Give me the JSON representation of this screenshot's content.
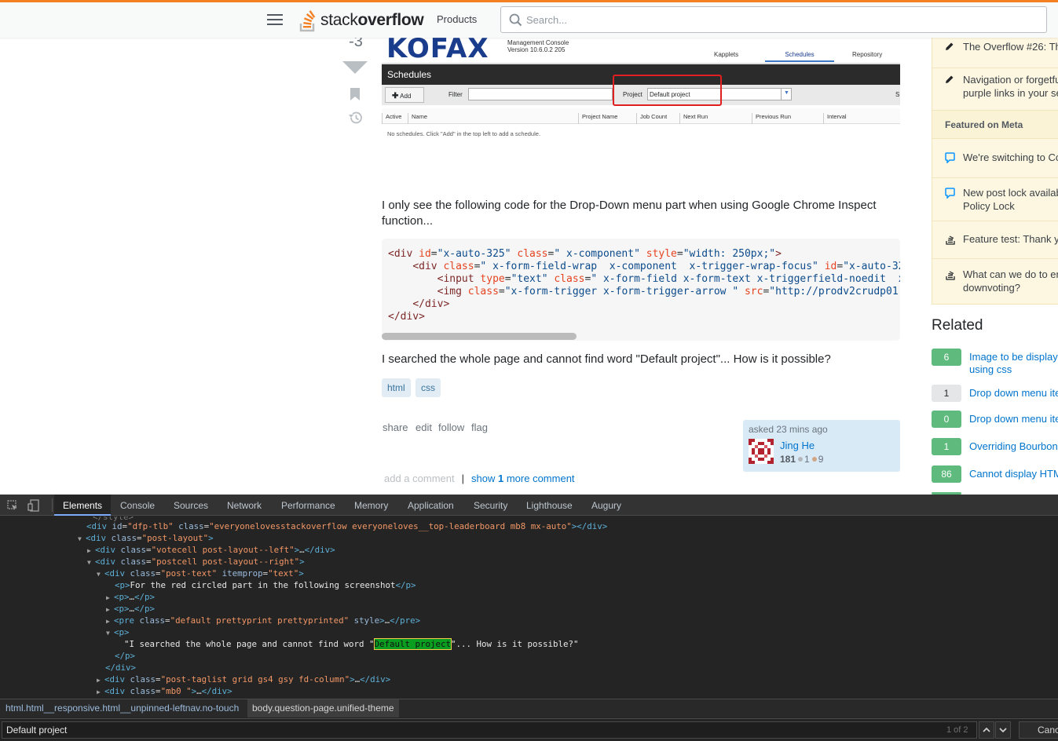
{
  "topbar": {
    "logo_prefix": "stack",
    "logo_bold": "overflow",
    "products_label": "Products",
    "search_placeholder": "Search..."
  },
  "vote": {
    "count": "-3"
  },
  "kofax_image": {
    "logo": "KOFAX",
    "subtitle_1": "Management Console",
    "subtitle_2": "Version 10.6.0.2 205",
    "tabs": [
      "Kapplets",
      "Schedules",
      "Repository"
    ],
    "header": "Schedules",
    "add_label": "Add",
    "filter_label": "Filter",
    "project_label": "Project",
    "project_value": "Default project",
    "trailing_label": "S",
    "columns": [
      "Active",
      "Name",
      "Project Name",
      "Job Count",
      "Next Run",
      "Previous Run",
      "Interval"
    ],
    "empty_message": "No schedules. Click \"Add\" in the top left to add a schedule."
  },
  "post": {
    "paragraph_1": "I only see the following code for the Drop-Down menu part when using Google Chrome Inspect function...",
    "code_lines": [
      [
        "<div ",
        "id",
        "=",
        "\"x-auto-325\"",
        " ",
        "class",
        "=",
        "\" x-component\"",
        " ",
        "style",
        "=",
        "\"width: 250px;\"",
        ">"
      ],
      [
        "    <div ",
        "class",
        "=",
        "\" x-form-field-wrap  x-component  x-trigger-wrap-focus\"",
        " ",
        "id",
        "=",
        "\"x-auto-32",
        "",
        "",
        "",
        "",
        ""
      ],
      [
        "        <input ",
        "type",
        "=",
        "\"text\"",
        " ",
        "class",
        "=",
        "\" x-form-field x-form-text x-triggerfield-noedit  x",
        "",
        "",
        "",
        "",
        ""
      ],
      [
        "        <img ",
        "class",
        "=",
        "\"x-form-trigger x-form-trigger-arrow \"",
        " ",
        "src",
        "=",
        "\"http://prodv2crudp01",
        "",
        "",
        "",
        "",
        ""
      ],
      [
        "    </div>",
        "",
        "",
        "",
        "",
        "",
        "",
        "",
        "",
        "",
        "",
        "",
        ""
      ],
      [
        "</div>",
        "",
        "",
        "",
        "",
        "",
        "",
        "",
        "",
        "",
        "",
        "",
        ""
      ]
    ],
    "paragraph_2": "I searched the whole page and cannot find word \"Default project\"... How is it possible?",
    "tags": [
      "html",
      "css"
    ],
    "menu": [
      "share",
      "edit",
      "follow",
      "flag"
    ],
    "owner": {
      "asked": "asked 23 mins ago",
      "name": "Jing He",
      "reputation": "181",
      "silver": "1",
      "bronze": "9"
    },
    "add_comment": "add a comment",
    "separator": "|",
    "show_more_prefix": "show",
    "show_more_count": "1",
    "show_more_suffix": "more comment"
  },
  "sidebar": {
    "blog_items": [
      "The Overflow #26: Th",
      "Navigation or forgetfu",
      "purple links in your se"
    ],
    "featured_meta_label": "Featured on Meta",
    "meta_items": [
      [
        "We're switching to Co",
        ""
      ],
      [
        "New post lock availab",
        "Policy Lock"
      ],
      [
        "Feature test: Thank y",
        ""
      ],
      [
        "What can we do to er",
        "downvoting?"
      ]
    ],
    "related_title": "Related",
    "related": [
      {
        "score": "6",
        "title": "Image to be display",
        "title2": "using css",
        "answered": true
      },
      {
        "score": "1",
        "title": "Drop down menu ite",
        "title2": "",
        "answered": false
      },
      {
        "score": "0",
        "title": "Drop down menu ite",
        "title2": "",
        "answered": true
      },
      {
        "score": "1",
        "title": "Overriding Bourbon",
        "title2": "",
        "answered": true
      },
      {
        "score": "86",
        "title": "Cannot display HTM",
        "title2": "",
        "answered": true
      }
    ]
  },
  "devtools": {
    "tabs": [
      "Elements",
      "Console",
      "Sources",
      "Network",
      "Performance",
      "Memory",
      "Application",
      "Security",
      "Lighthouse",
      "Augury"
    ],
    "breadcrumbs": [
      "html.html__responsive.html__unpinned-leftnav.no-touch",
      "body.question-page.unified-theme"
    ],
    "search_value": "Default project",
    "match_count": "1 of 2",
    "cancel_label": "Cancel",
    "tree": {
      "l1_id": "dfp-tlb",
      "l1_class": "everyonelovesstackoverflow everyoneloves__top-leaderboard mb8 mx-auto",
      "l2_class": "post-layout",
      "l3_class": "votecell post-layout--left",
      "l4_class": "postcell post-layout--right",
      "l5_class": "post-text",
      "l5_itemprop": "text",
      "l6_text": "For the red circled part in the following screenshot",
      "l9_class": "default prettyprint prettyprinted",
      "l11_before": "\"I searched the whole page and cannot find word \"",
      "l11_match": "Default project",
      "l11_after": "\"... How is it possible?\"",
      "l14_class": "post-taglist grid gs4 gsy fd-column",
      "l15_class": "mb0 "
    }
  }
}
